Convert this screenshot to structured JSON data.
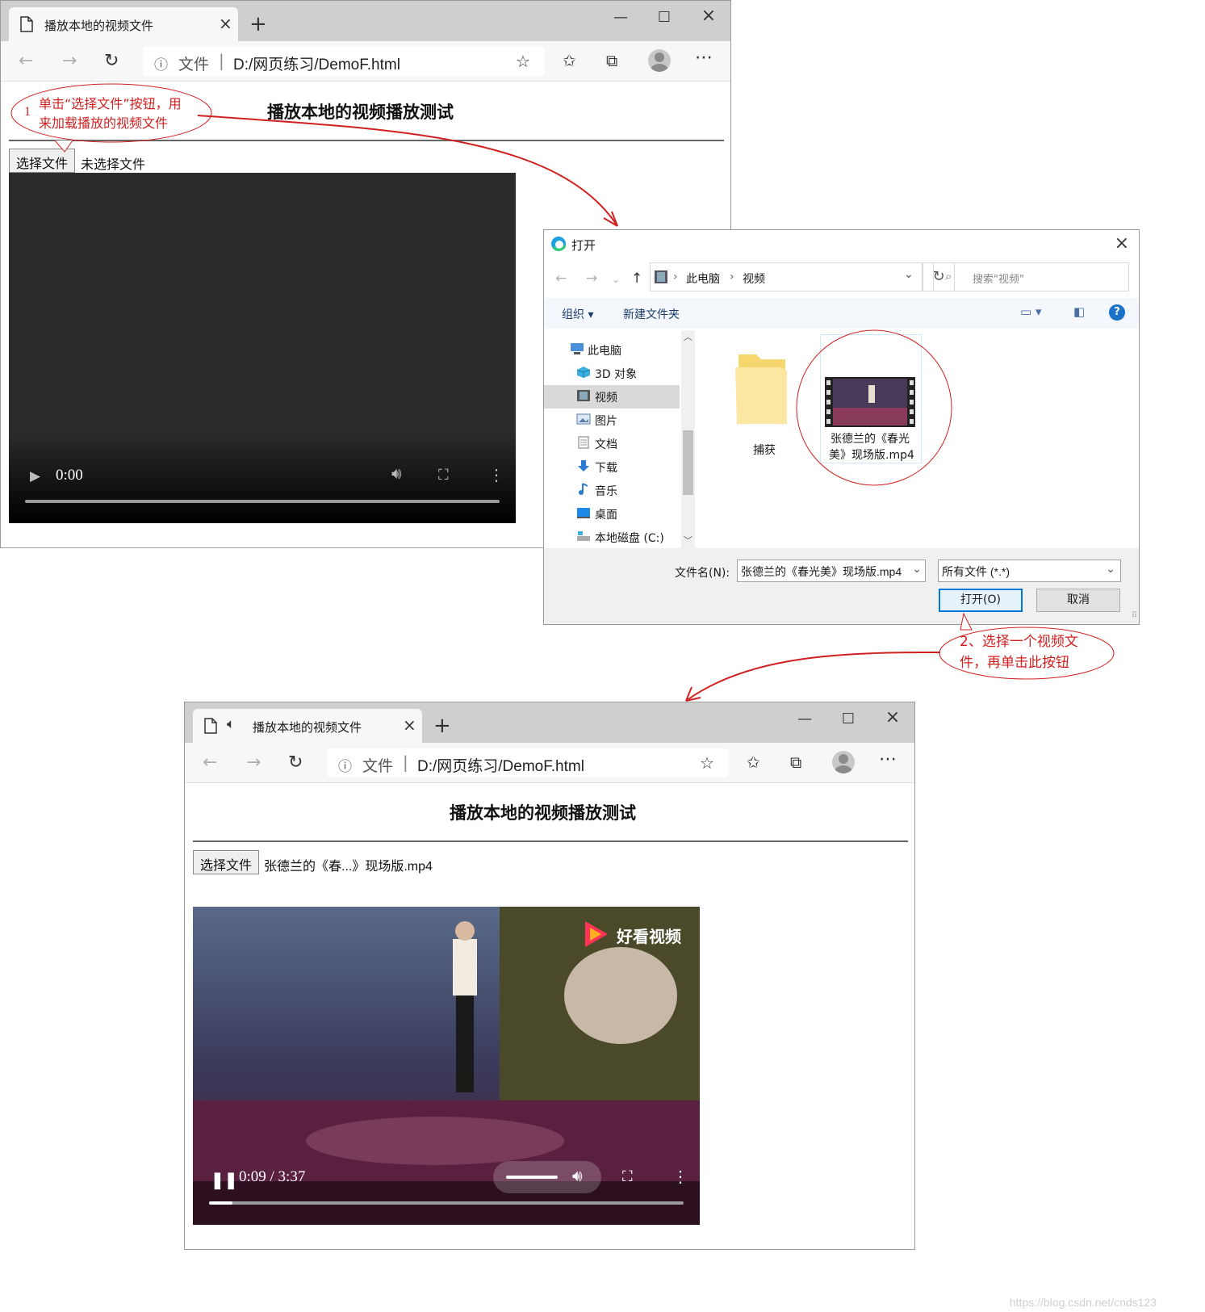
{
  "browser1": {
    "tab_title": "播放本地的视频文件",
    "url_label": "文件",
    "url": "D:/网页练习/DemoF.html",
    "page_title": "播放本地的视频播放测试",
    "file_button": "选择文件",
    "file_status": "未选择文件",
    "video_time": "0:00"
  },
  "callout1": {
    "number": "1",
    "line1": "单击“选择文件”按钮，用",
    "line2": "来加载播放的视频文件"
  },
  "dialog": {
    "title": "打开",
    "breadcrumb": [
      "此电脑",
      "视频"
    ],
    "search_placeholder": "搜索\"视频\"",
    "organize": "组织 ▾",
    "new_folder": "新建文件夹",
    "tree": [
      {
        "label": "此电脑",
        "icon": "computer-icon"
      },
      {
        "label": "3D 对象",
        "icon": "cube-icon"
      },
      {
        "label": "视频",
        "icon": "video-folder-icon",
        "selected": true
      },
      {
        "label": "图片",
        "icon": "picture-icon"
      },
      {
        "label": "文档",
        "icon": "document-icon"
      },
      {
        "label": "下载",
        "icon": "download-icon"
      },
      {
        "label": "音乐",
        "icon": "music-icon"
      },
      {
        "label": "桌面",
        "icon": "desktop-icon"
      },
      {
        "label": "本地磁盘 (C:)",
        "icon": "disk-icon"
      }
    ],
    "folder_name": "捕获",
    "file_name_line1": "张德兰的《春光",
    "file_name_line2": "美》现场版.mp4",
    "filename_label": "文件名(N):",
    "filename_value": "张德兰的《春光美》现场版.mp4",
    "filetype_value": "所有文件 (*.*)",
    "open_button": "打开(O)",
    "cancel_button": "取消"
  },
  "callout2": {
    "line1": "2、选择一个视频文",
    "line2": "件，再单击此按钮"
  },
  "browser2": {
    "tab_title": "播放本地的视频文件",
    "url_label": "文件",
    "url": "D:/网页练习/DemoF.html",
    "page_title": "播放本地的视频播放测试",
    "file_button": "选择文件",
    "file_status": "张德兰的《春...》现场版.mp4",
    "video_time": "0:09 / 3:37",
    "video_watermark": "好看视频",
    "progress": 0.05
  },
  "watermark": "https://blog.csdn.net/cnds123"
}
